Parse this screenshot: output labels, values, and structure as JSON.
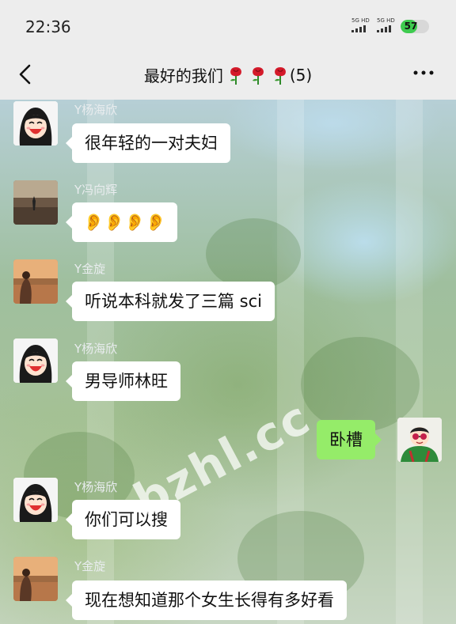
{
  "status_bar": {
    "time": "22:36",
    "signal_1": "5G HD",
    "signal_2": "5G HD",
    "battery": "57",
    "battery_level_percent": 57
  },
  "header": {
    "title": "最好的我们",
    "rose_icons": [
      "rose-icon",
      "rose-icon",
      "rose-icon"
    ],
    "member_count": "(5)",
    "back_icon": "chevron-left-icon",
    "more_icon": "more-dots-icon"
  },
  "messages": [
    {
      "sender": "Y杨海欣",
      "text": "很年轻的一对夫妇",
      "direction": "in"
    },
    {
      "sender": "Y冯向辉",
      "text": "👂👂👂👂",
      "direction": "in"
    },
    {
      "sender": "Y金旋",
      "text": "听说本科就发了三篇 sci",
      "direction": "in"
    },
    {
      "sender": "Y杨海欣",
      "text": "男导师林旺",
      "direction": "in"
    },
    {
      "sender": "",
      "text": "卧槽",
      "direction": "out"
    },
    {
      "sender": "Y杨海欣",
      "text": "你们可以搜",
      "direction": "in"
    },
    {
      "sender": "Y金旋",
      "text": "现在想知道那个女生长得有多好看",
      "direction": "in"
    }
  ],
  "watermark": "bzhl.cc",
  "colors": {
    "outgoing_bubble": "#95ec69",
    "incoming_bubble": "#ffffff",
    "battery": "#3ecb4f"
  }
}
